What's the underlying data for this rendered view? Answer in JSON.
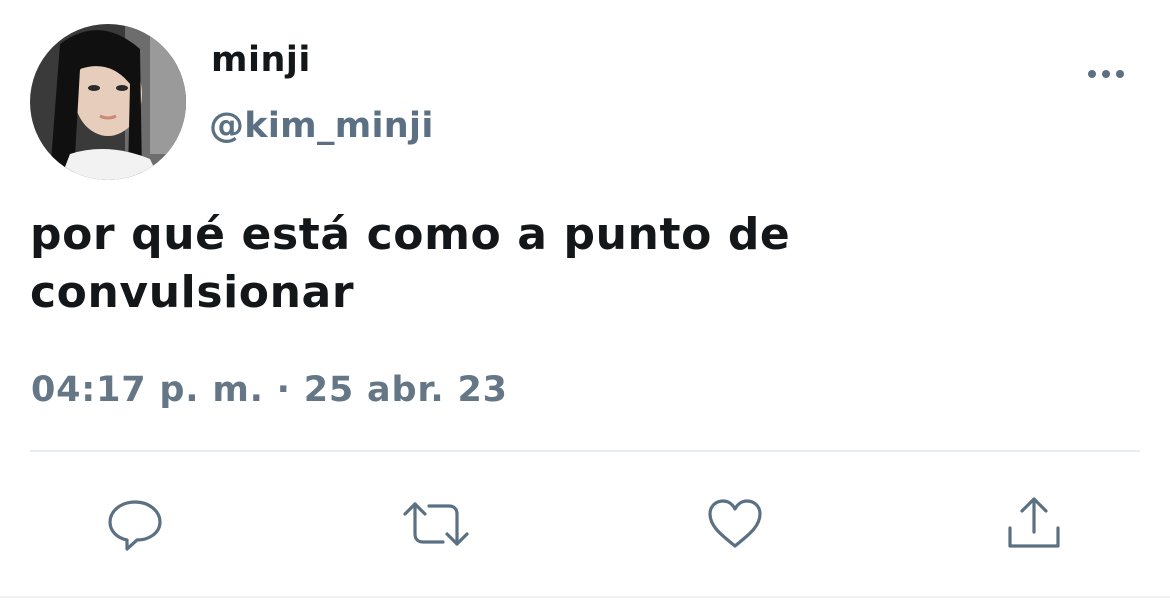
{
  "tweet": {
    "display_name": "minji",
    "handle": "@kim_minji",
    "text_line1": "por qué está como a punto de",
    "text_line2": "convulsionar",
    "timestamp": "04:17 p. m. · 25 abr. 23"
  },
  "icons": {
    "more": "more-options-icon",
    "reply": "reply-icon",
    "retweet": "retweet-icon",
    "like": "heart-icon",
    "share": "share-icon"
  },
  "colors": {
    "text": "#14171a",
    "secondary": "#5b7083",
    "icon": "#5b7083",
    "divider": "#e6ecf0"
  }
}
